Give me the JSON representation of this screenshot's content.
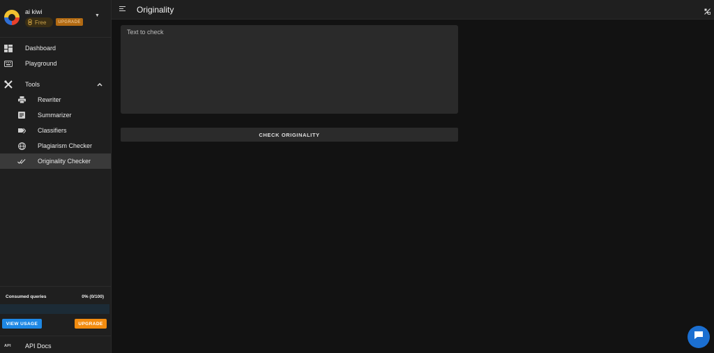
{
  "account": {
    "name": "ai kiwi",
    "plan": "Free",
    "upgrade_label": "UPGRADE"
  },
  "nav": {
    "dashboard": "Dashboard",
    "playground": "Playground",
    "tools": "Tools",
    "tools_items": [
      {
        "label": "Rewriter",
        "icon": "print-icon"
      },
      {
        "label": "Summarizer",
        "icon": "document-icon"
      },
      {
        "label": "Classifiers",
        "icon": "tags-icon"
      },
      {
        "label": "Plagiarism Checker",
        "icon": "globe-icon"
      },
      {
        "label": "Originality Checker",
        "icon": "double-check-icon",
        "active": true
      }
    ]
  },
  "usage": {
    "label": "Consumed queries",
    "value": "0% (0/100)",
    "fraction": 0,
    "view_usage_label": "VIEW USAGE",
    "upgrade_label": "UPGRADE"
  },
  "api": {
    "icon_text": "API",
    "label": "API Docs"
  },
  "header": {
    "title": "Originality"
  },
  "main": {
    "text_placeholder": "Text to check",
    "check_button": "CHECK ORIGINALITY"
  },
  "colors": {
    "accent_blue": "#1e88e5",
    "accent_orange": "#f28c10",
    "background": "#121212",
    "sidebar": "#1f1f1f"
  }
}
